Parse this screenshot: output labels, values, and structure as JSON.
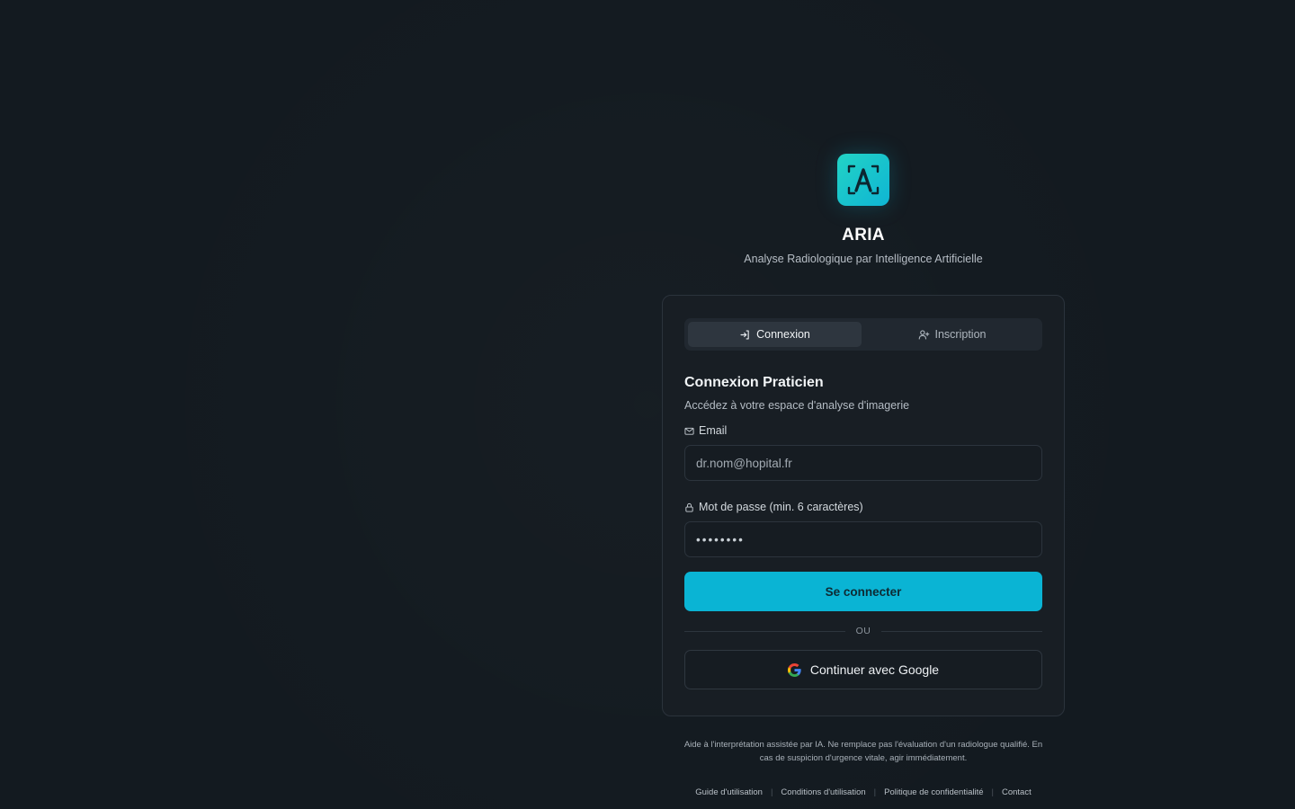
{
  "brand": {
    "logo_icon": "aria-logo-icon",
    "name": "ARIA",
    "tagline": "Analyse Radiologique par Intelligence Artificielle",
    "accent_color": "#0ab4d4"
  },
  "tabs": [
    {
      "label": "Connexion",
      "icon": "login-icon",
      "active": true
    },
    {
      "label": "Inscription",
      "icon": "user-plus-icon",
      "active": false
    }
  ],
  "form": {
    "title": "Connexion Praticien",
    "subtitle": "Accédez à votre espace d'analyse d'imagerie",
    "email_label": "Email",
    "email_placeholder": "dr.nom@hopital.fr",
    "password_label": "Mot de passe (min. 6 caractères)",
    "password_value": "••••••••",
    "submit_label": "Se connecter",
    "divider_text": "OU",
    "google_label": "Continuer avec Google"
  },
  "footer": {
    "disclaimer": "Aide à l'interprétation assistée par IA. Ne remplace pas l'évaluation d'un radiologue qualifié. En cas de suspicion d'urgence vitale, agir immédiatement.",
    "links": [
      "Guide d'utilisation",
      "Conditions d'utilisation",
      "Politique de confidentialité",
      "Contact"
    ]
  }
}
